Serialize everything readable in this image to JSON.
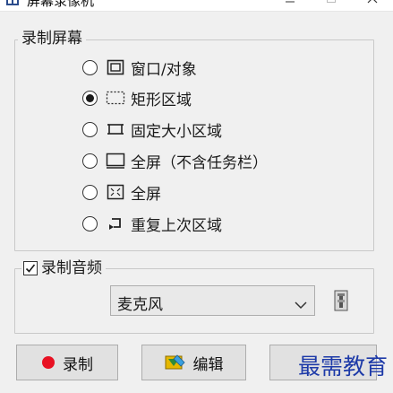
{
  "window": {
    "title": "屏幕录像机"
  },
  "record_screen": {
    "legend": "录制屏幕",
    "options": [
      {
        "label": "窗口/对象",
        "icon": "window-object-icon",
        "checked": false
      },
      {
        "label": "矩形区域",
        "icon": "rectangle-region-icon",
        "checked": true
      },
      {
        "label": "固定大小区域",
        "icon": "fixed-size-region-icon",
        "checked": false
      },
      {
        "label": "全屏（不含任务栏）",
        "icon": "fullscreen-no-taskbar-icon",
        "checked": false
      },
      {
        "label": "全屏",
        "icon": "fullscreen-icon",
        "checked": false
      },
      {
        "label": "重复上次区域",
        "icon": "repeat-last-region-icon",
        "checked": false
      }
    ]
  },
  "record_audio": {
    "legend": "录制音频",
    "checked": true,
    "device": "麦克风"
  },
  "buttons": {
    "record": "录制",
    "edit": "编辑"
  },
  "watermark": "最需教育",
  "colors": {
    "record_red": "#e81123",
    "watermark_blue": "#1d3aa8",
    "window_bg": "#f0f0f0"
  }
}
